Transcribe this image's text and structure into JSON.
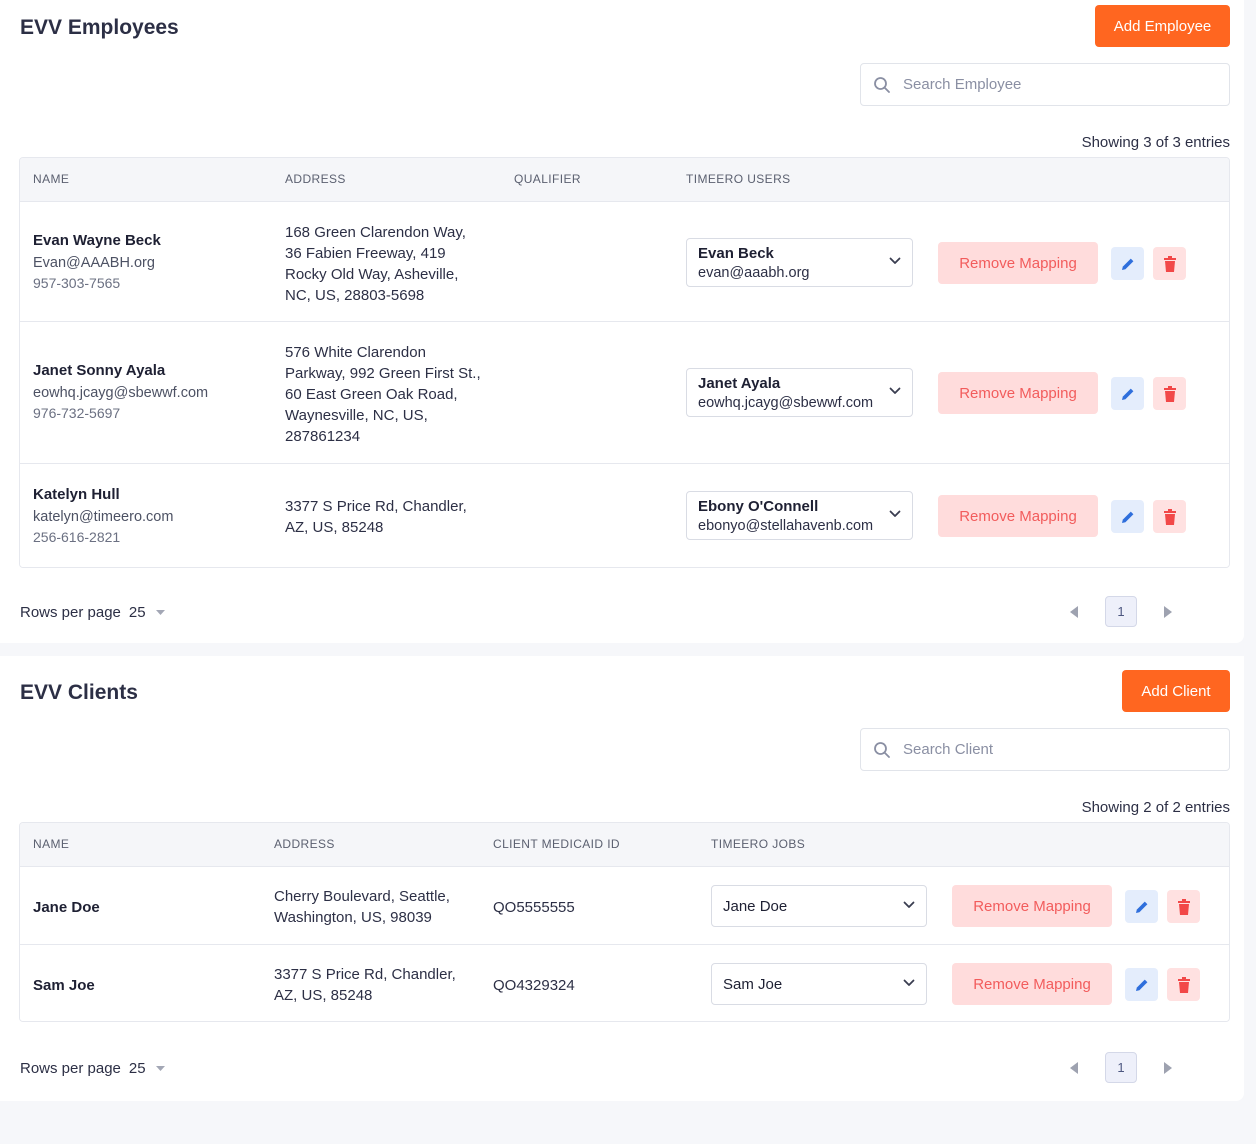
{
  "employees": {
    "title": "EVV Employees",
    "add_label": "Add Employee",
    "search_placeholder": "Search Employee",
    "showing": "Showing 3 of 3 entries",
    "columns": [
      "NAME",
      "ADDRESS",
      "QUALIFIER",
      "TIMEERO USERS"
    ],
    "rows": [
      {
        "name": "Evan Wayne Beck",
        "email": "Evan@AAABH.org",
        "phone": "957-303-7565",
        "address": [
          "168 Green Clarendon Way,",
          "36 Fabien Freeway, 419",
          "Rocky Old Way, Asheville,",
          "NC, US, 28803-5698"
        ],
        "qualifier": "",
        "user_name": "Evan Beck",
        "user_email": "evan@aaabh.org",
        "remove_label": "Remove Mapping"
      },
      {
        "name": "Janet Sonny Ayala",
        "email": "eowhq.jcayg@sbewwf.com",
        "phone": "976-732-5697",
        "address": [
          "576 White Clarendon",
          "Parkway, 992 Green First St.,",
          "60 East Green Oak Road,",
          "Waynesville, NC, US,",
          "287861234"
        ],
        "qualifier": "",
        "user_name": "Janet Ayala",
        "user_email": "eowhq.jcayg@sbewwf.com",
        "remove_label": "Remove Mapping"
      },
      {
        "name": "Katelyn Hull",
        "email": "katelyn@timeero.com",
        "phone": "256-616-2821",
        "address": [
          "3377 S Price Rd, Chandler,",
          "AZ, US, 85248"
        ],
        "qualifier": "",
        "user_name": "Ebony O'Connell",
        "user_email": "ebonyo@stellahavenb.com",
        "remove_label": "Remove Mapping"
      }
    ],
    "rows_per_page_label": "Rows per page",
    "rows_per_page_value": "25",
    "current_page": "1"
  },
  "clients": {
    "title": "EVV Clients",
    "add_label": "Add Client",
    "search_placeholder": "Search Client",
    "showing": "Showing 2 of 2 entries",
    "columns": [
      "NAME",
      "ADDRESS",
      "CLIENT MEDICAID ID",
      "TIMEERO JOBS"
    ],
    "rows": [
      {
        "name": "Jane Doe",
        "address": [
          "Cherry Boulevard, Seattle,",
          "Washington, US, 98039"
        ],
        "medicaid_id": "QO5555555",
        "job": "Jane Doe",
        "remove_label": "Remove Mapping"
      },
      {
        "name": "Sam Joe",
        "address": [
          "3377 S Price Rd, Chandler,",
          "AZ, US, 85248"
        ],
        "medicaid_id": "QO4329324",
        "job": "Sam Joe",
        "remove_label": "Remove Mapping"
      }
    ],
    "rows_per_page_label": "Rows per page",
    "rows_per_page_value": "25",
    "current_page": "1"
  },
  "colors": {
    "primary": "#ff6620",
    "remove_bg": "#ffdcdc",
    "remove_text": "#f25c5c",
    "edit_icon": "#2f6fdc",
    "delete_icon": "#f24848"
  },
  "icons": [
    "search-icon",
    "chevron-down-icon",
    "pencil-icon",
    "trash-icon",
    "caret-down-icon",
    "arrow-left-icon",
    "arrow-right-icon"
  ]
}
